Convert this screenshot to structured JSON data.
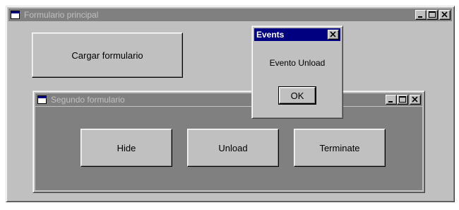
{
  "main_form": {
    "title": "Formulario principal",
    "load_button_label": "Cargar formulario"
  },
  "second_form": {
    "title": "Segundo formulario",
    "buttons": {
      "hide": "Hide",
      "unload": "Unload",
      "terminate": "Terminate"
    }
  },
  "message_box": {
    "title": "Events",
    "message": "Evento Unload",
    "ok_label": "OK"
  },
  "colors": {
    "face": "#c0c0c0",
    "inactive_title": "#808080",
    "active_title": "#000080",
    "inner_client": "#808080"
  },
  "icons": [
    "form-icon",
    "minimize-icon",
    "maximize-icon",
    "close-icon"
  ]
}
